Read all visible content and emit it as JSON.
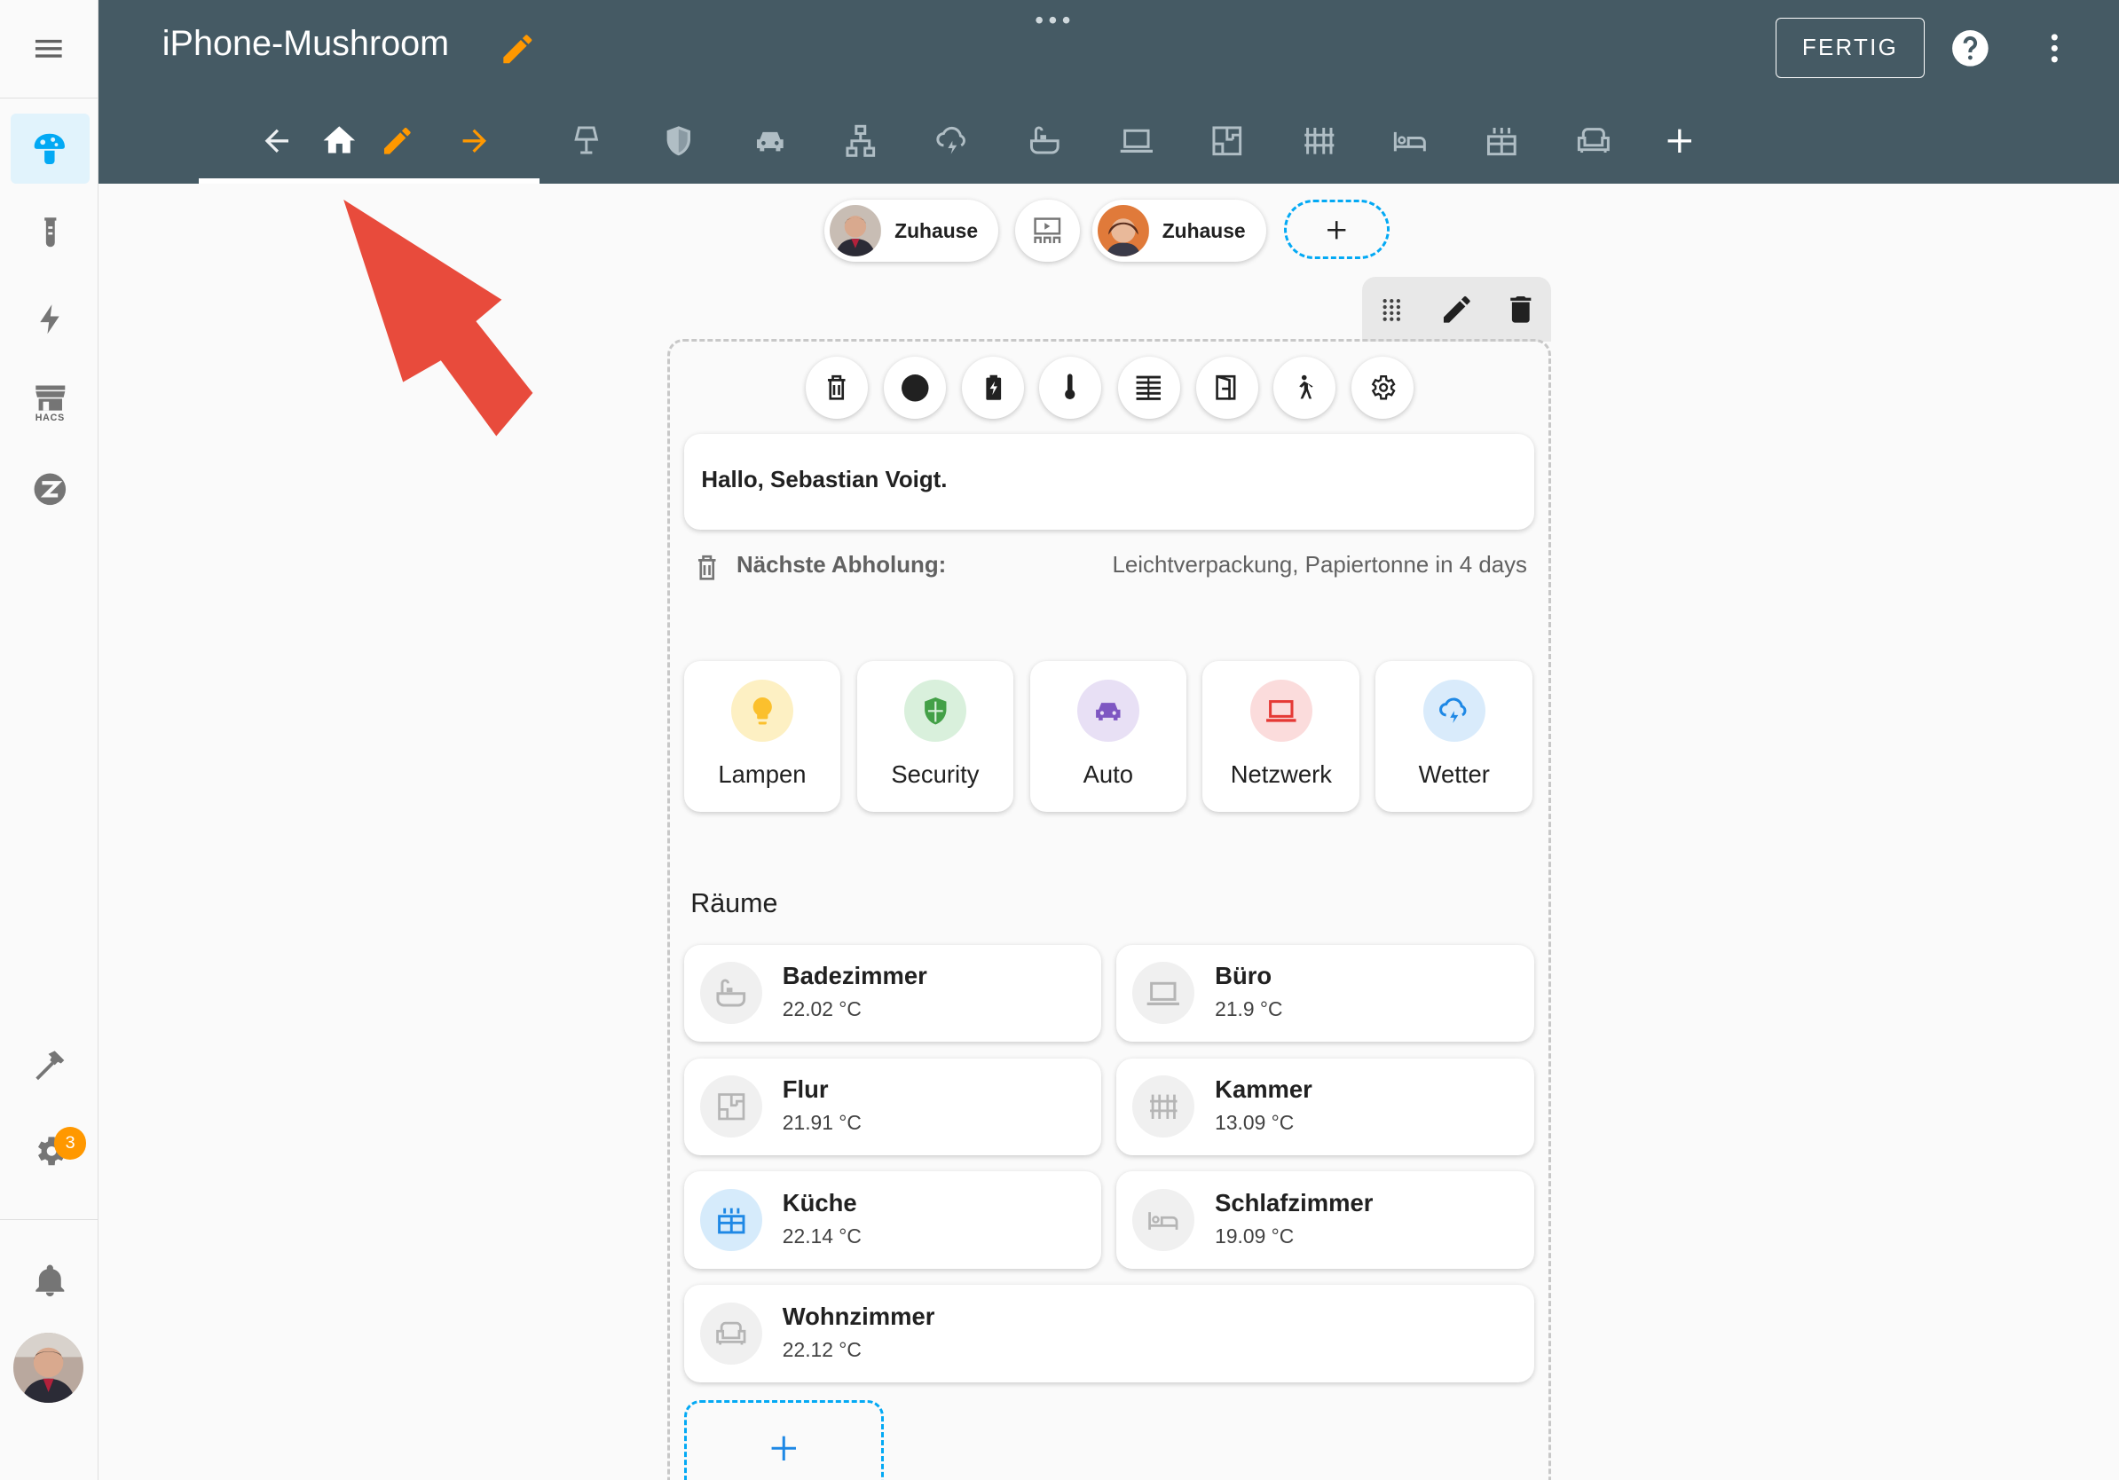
{
  "header": {
    "title": "iPhone-Mushroom",
    "done_label": "FERTIG"
  },
  "sidebar": {
    "notification_count": "3",
    "hacs_label": "HACS"
  },
  "badges": [
    {
      "label": "Zuhause"
    },
    {
      "label": "Zuhause"
    }
  ],
  "greeting": "Hallo, Sebastian Voigt.",
  "waste": {
    "label": "Nächste Abholung:",
    "value": "Leichtverpackung, Papiertonne in 4 days"
  },
  "templates": [
    {
      "label": "Lampen",
      "icon": "lightbulb-icon",
      "color": "#fbc02d"
    },
    {
      "label": "Security",
      "icon": "shield-icon",
      "color": "#43a047"
    },
    {
      "label": "Auto",
      "icon": "car-icon",
      "color": "#7e57c2"
    },
    {
      "label": "Netzwerk",
      "icon": "laptop-icon",
      "color": "#e53935"
    },
    {
      "label": "Wetter",
      "icon": "weather-lightning-icon",
      "color": "#1e88e5"
    }
  ],
  "rooms_title": "Räume",
  "rooms": [
    {
      "name": "Badezimmer",
      "temp": "22.02 °C",
      "icon": "bathtub-icon"
    },
    {
      "name": "Büro",
      "temp": "21.9 °C",
      "icon": "laptop-icon"
    },
    {
      "name": "Flur",
      "temp": "21.91 °C",
      "icon": "floor-plan-icon"
    },
    {
      "name": "Kammer",
      "temp": "13.09 °C",
      "icon": "shelves-icon"
    },
    {
      "name": "Küche",
      "temp": "22.14 °C",
      "icon": "stove-icon"
    },
    {
      "name": "Schlafzimmer",
      "temp": "19.09 °C",
      "icon": "bed-icon"
    },
    {
      "name": "Wohnzimmer",
      "temp": "22.12 °C",
      "icon": "sofa-icon"
    }
  ],
  "colors": {
    "header_bg": "#455a64",
    "accent_orange": "#ff9800",
    "primary_blue": "#03a9f4",
    "annotation_arrow": "#e84b3c"
  }
}
